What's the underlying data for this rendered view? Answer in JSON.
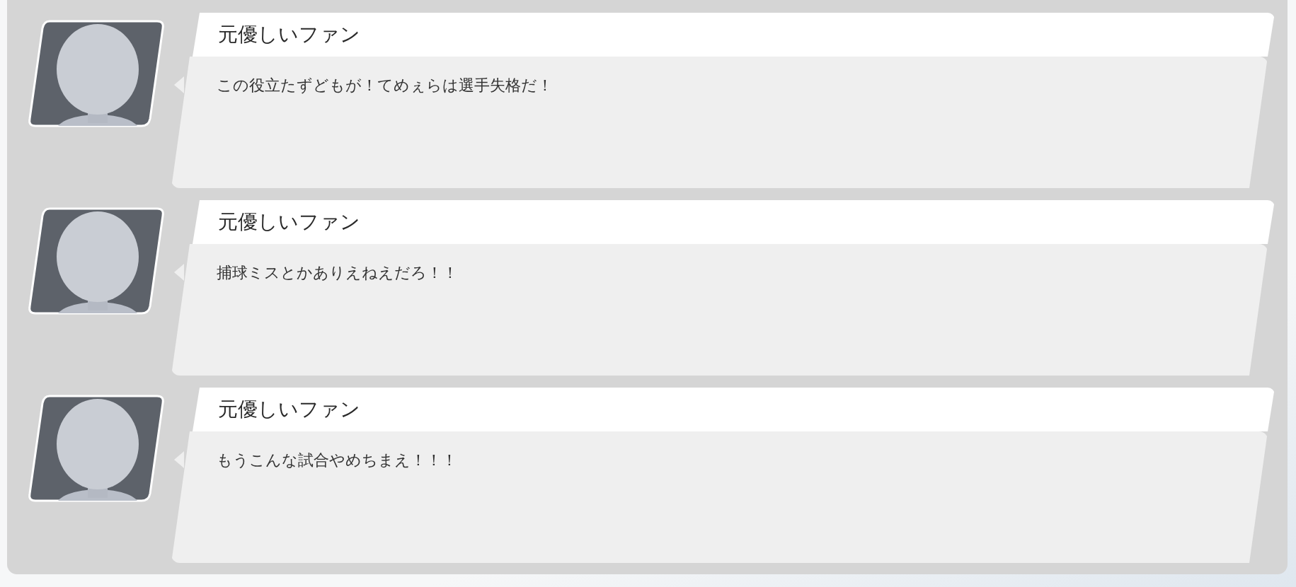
{
  "comments": [
    {
      "name": "元優しいファン",
      "message": "この役立たずどもが！てめぇらは選手失格だ！"
    },
    {
      "name": "元優しいファン",
      "message": "捕球ミスとかありえねえだろ！！"
    },
    {
      "name": "元優しいファン",
      "message": "もうこんな試合やめちまえ！！！"
    }
  ]
}
